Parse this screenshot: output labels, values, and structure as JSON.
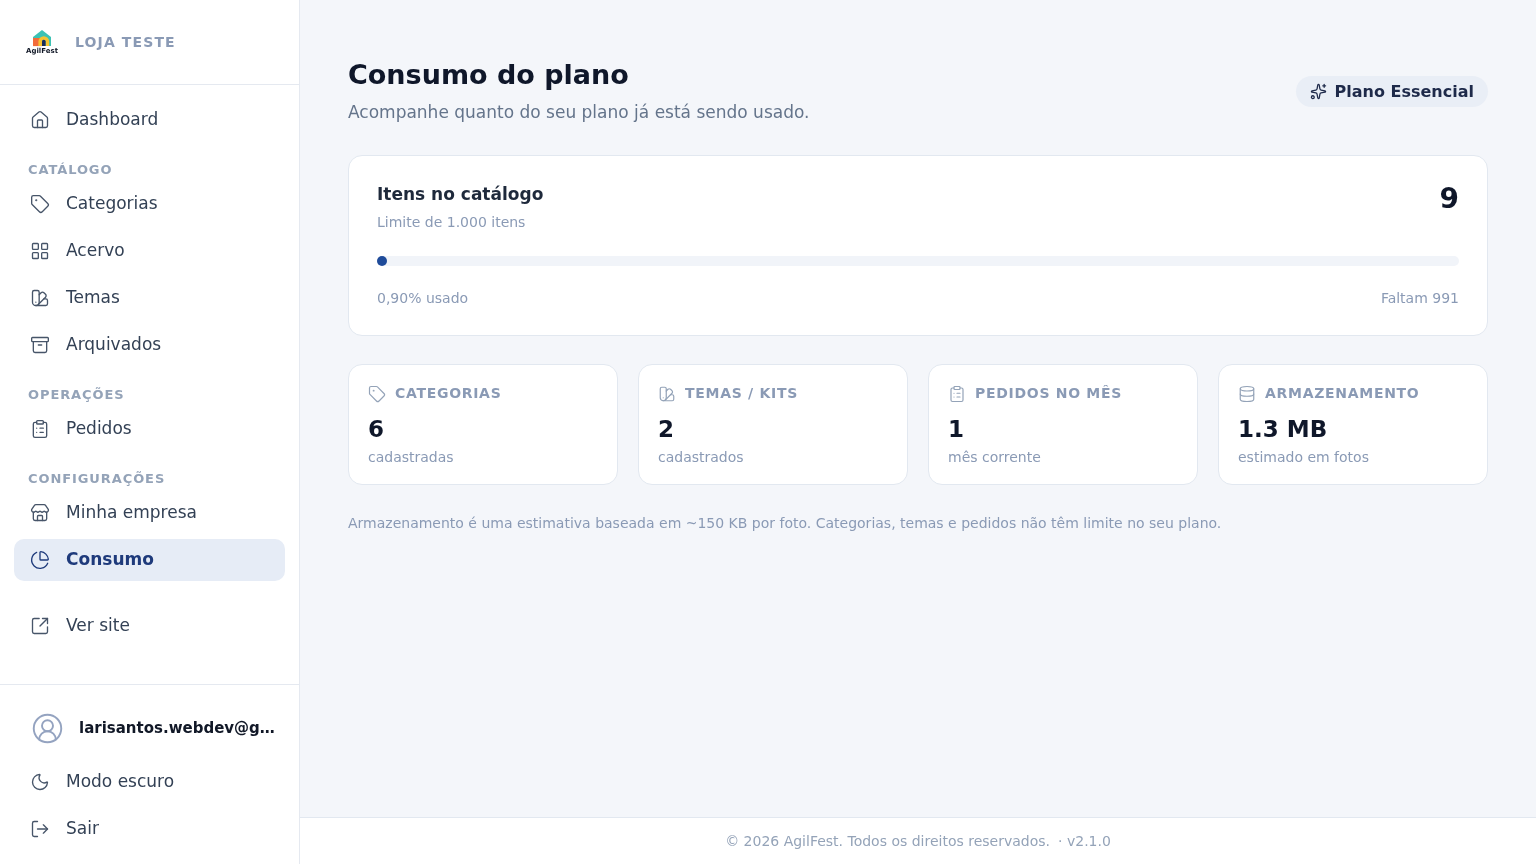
{
  "sidebar": {
    "brand": {
      "logo_text": "AgilFest",
      "store_name": "LOJA TESTE"
    },
    "nav": [
      {
        "kind": "item",
        "label": "Dashboard",
        "selected": false
      },
      {
        "kind": "heading",
        "label": "CATÁLOGO"
      },
      {
        "kind": "item",
        "label": "Categorias",
        "selected": false
      },
      {
        "kind": "item",
        "label": "Acervo",
        "selected": false
      },
      {
        "kind": "item",
        "label": "Temas",
        "selected": false
      },
      {
        "kind": "item",
        "label": "Arquivados",
        "selected": false
      },
      {
        "kind": "heading",
        "label": "OPERAÇÕES"
      },
      {
        "kind": "item",
        "label": "Pedidos",
        "selected": false
      },
      {
        "kind": "heading",
        "label": "CONFIGURAÇÕES"
      },
      {
        "kind": "item",
        "label": "Minha empresa",
        "selected": false
      },
      {
        "kind": "item",
        "label": "Consumo",
        "selected": true
      }
    ],
    "site_link": {
      "label": "Ver site"
    },
    "user": {
      "email": "larisantos.webdev@g…"
    },
    "actions": [
      {
        "label": "Modo escuro"
      },
      {
        "label": "Sair"
      }
    ]
  },
  "header": {
    "title": "Consumo do plano",
    "subtitle": "Acompanhe quanto do seu plano já está sendo usado.",
    "plan_badge": "Plano Essencial"
  },
  "usage_card": {
    "title": "Itens no catálogo",
    "limit": "Limite de 1.000 itens",
    "count": "9",
    "level": 0.009,
    "used": "0,90% usado",
    "remaining": "Faltam 991"
  },
  "stats": [
    {
      "label": "CATEGORIAS",
      "value": "6",
      "caption": "cadastradas"
    },
    {
      "label": "TEMAS / KITS",
      "value": "2",
      "caption": "cadastrados"
    },
    {
      "label": "PEDIDOS NO MÊS",
      "value": "1",
      "caption": "mês corrente"
    },
    {
      "label": "ARMAZENAMENTO",
      "value": "1.3 MB",
      "caption": "estimado em fotos"
    }
  ],
  "note": "Armazenamento é uma estimativa baseada em ~150 KB por foto. Categorias, temas e pedidos não têm limite no seu plano.",
  "footer": {
    "copyright": "© 2026 AgilFest. Todos os direitos reservados.",
    "version": "· v2.1.0"
  }
}
